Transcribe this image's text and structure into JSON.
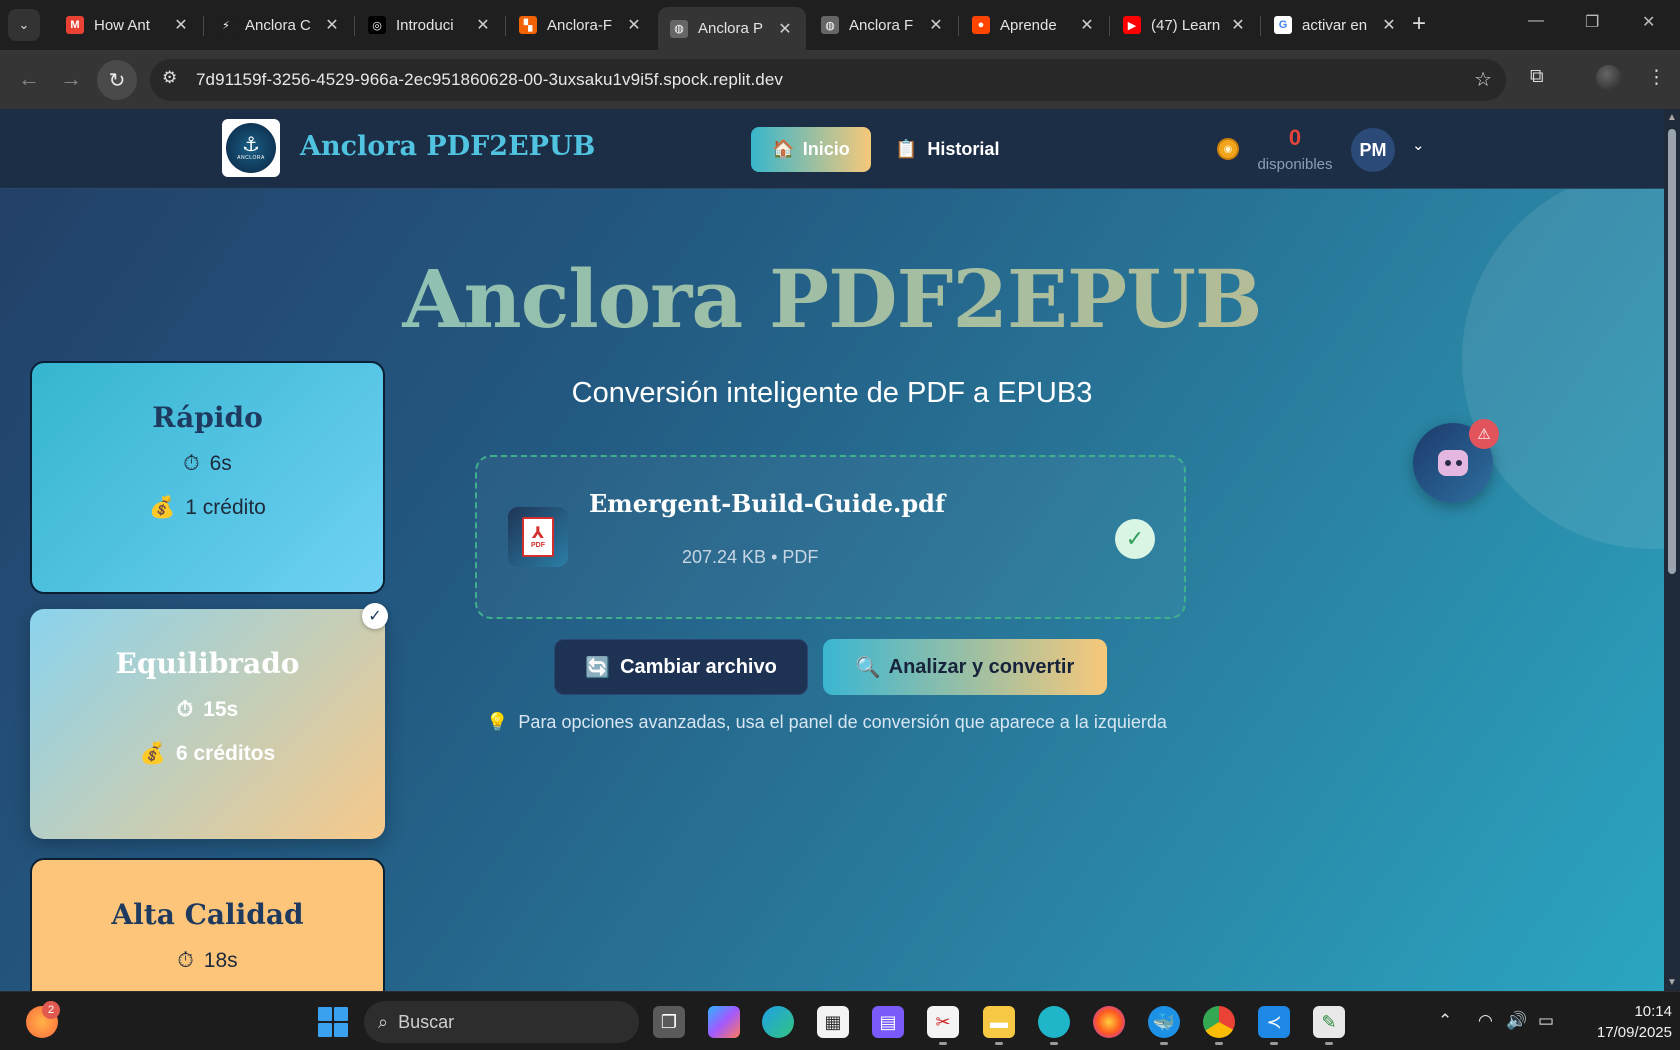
{
  "browser": {
    "tabs": [
      {
        "title": "How Ant",
        "color": "#e94235",
        "glyph": "M"
      },
      {
        "title": "Anclora C",
        "color": "#1f1f1f",
        "glyph": "⚡"
      },
      {
        "title": "Introduci",
        "color": "#000000",
        "glyph": "◎"
      },
      {
        "title": "Anclora-F",
        "color": "#f26207",
        "glyph": "▚"
      },
      {
        "title": "Anclora P",
        "color": "#666666",
        "glyph": "◍"
      },
      {
        "title": "Anclora F",
        "color": "#666666",
        "glyph": "◍"
      },
      {
        "title": "Aprende",
        "color": "#ff4500",
        "glyph": "●"
      },
      {
        "title": "(47) Learn",
        "color": "#ff0000",
        "glyph": "▶"
      },
      {
        "title": "activar en",
        "color": "#ffffff",
        "glyph": "G"
      }
    ],
    "active_tab_index": 4,
    "url": "7d91159f-3256-4529-966a-2ec951860628-00-3uxsaku1v9i5f.spock.replit.dev"
  },
  "app": {
    "brand": "Anclora PDF2EPUB",
    "logo_word": "ANCLORA",
    "nav": {
      "inicio": "Inicio",
      "historial": "Historial"
    },
    "credits": {
      "count": "0",
      "label": "disponibles"
    },
    "user_initials": "PM"
  },
  "hero": {
    "title": "Anclora PDF2EPUB",
    "subtitle": "Conversión inteligente de PDF a EPUB3"
  },
  "modes": [
    {
      "title": "Rápido",
      "time": "6s",
      "cost": "1 crédito",
      "selected": false
    },
    {
      "title": "Equilibrado",
      "time": "15s",
      "cost": "6 créditos",
      "selected": true
    },
    {
      "title": "Alta Calidad",
      "time": "18s",
      "cost": "",
      "selected": false
    }
  ],
  "file": {
    "name": "Emergent-Build-Guide.pdf",
    "meta": "207.24 KB • PDF",
    "icon_label": "PDF"
  },
  "actions": {
    "change": "Cambiar archivo",
    "analyze": "Analizar y convertir"
  },
  "tip": "Para opciones avanzadas, usa el panel de conversión que aparece a la izquierda",
  "taskbar": {
    "search_placeholder": "Buscar",
    "notification_count": "2",
    "time": "10:14",
    "date": "17/09/2025"
  }
}
